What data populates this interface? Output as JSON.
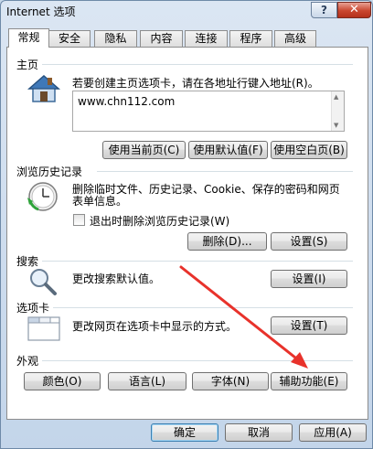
{
  "window": {
    "title": "Internet 选项",
    "help_label": "?",
    "close_label": "✕"
  },
  "tabs": [
    {
      "label": "常规",
      "active": true
    },
    {
      "label": "安全"
    },
    {
      "label": "隐私"
    },
    {
      "label": "内容"
    },
    {
      "label": "连接"
    },
    {
      "label": "程序"
    },
    {
      "label": "高级"
    }
  ],
  "homepage": {
    "title": "主页",
    "description": "若要创建主页选项卡，请在各地址行键入地址(R)。",
    "url": "www.chn112.com",
    "btn_current": "使用当前页(C)",
    "btn_default": "使用默认值(F)",
    "btn_blank": "使用空白页(B)"
  },
  "history": {
    "title": "浏览历史记录",
    "description_line1": "删除临时文件、历史记录、Cookie、保存的密码和网页",
    "description_line2": "表单信息。",
    "checkbox_label": "退出时删除浏览历史记录(W)",
    "checkbox_checked": false,
    "btn_delete": "删除(D)...",
    "btn_settings": "设置(S)"
  },
  "search": {
    "title": "搜索",
    "description": "更改搜索默认值。",
    "btn_settings": "设置(I)"
  },
  "tabs_section": {
    "title": "选项卡",
    "description": "更改网页在选项卡中显示的方式。",
    "btn_settings": "设置(T)"
  },
  "appearance": {
    "title": "外观",
    "btn_colors": "颜色(O)",
    "btn_languages": "语言(L)",
    "btn_fonts": "字体(N)",
    "btn_accessibility": "辅助功能(E)"
  },
  "footer": {
    "btn_ok": "确定",
    "btn_cancel": "取消",
    "btn_apply": "应用(A)"
  },
  "colors": {
    "annotation_arrow": "#e8322b"
  }
}
